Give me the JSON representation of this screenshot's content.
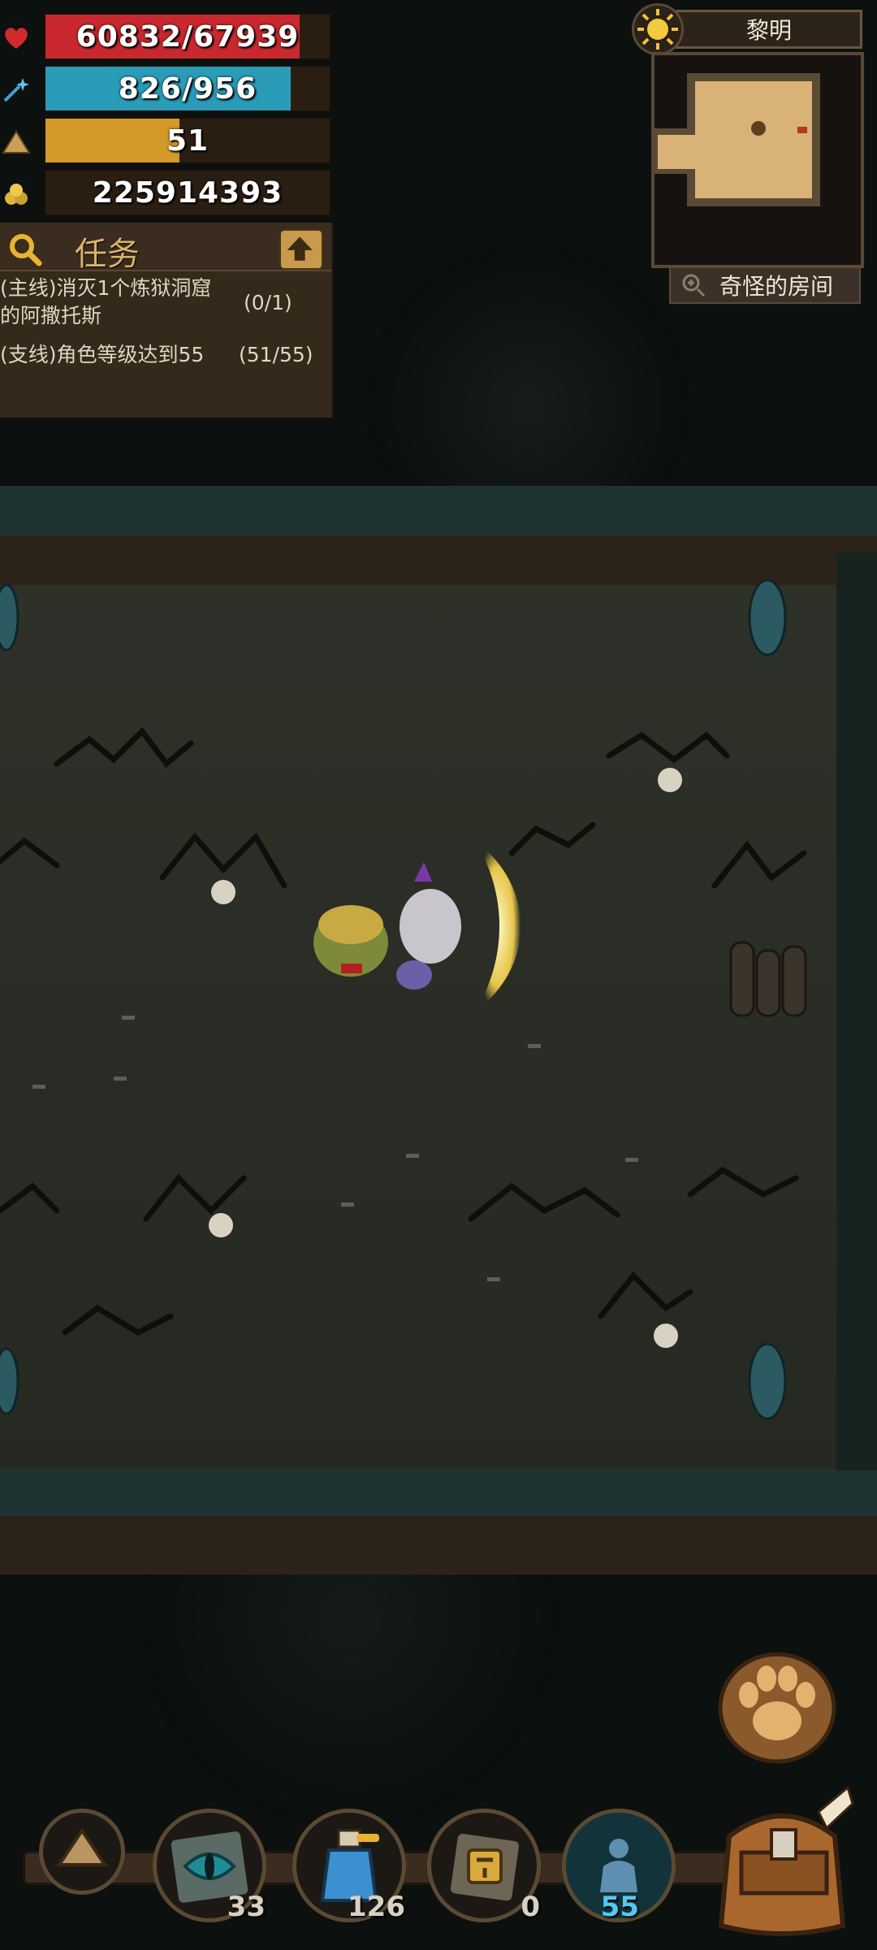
{
  "hud": {
    "hp": {
      "text": "60832/67939",
      "fraction": 0.895,
      "color": "#c9282e",
      "icon": "heart-icon"
    },
    "mp": {
      "text": "826/956",
      "fraction": 0.864,
      "color": "#2a9cb8",
      "icon": "magic-wand-icon"
    },
    "level": {
      "text": "51",
      "fraction": 0.47,
      "color": "#d39a2a",
      "icon": "level-triangle-icon"
    },
    "gold": {
      "text": "225914393",
      "color": "#d1a43a",
      "icon": "gold-pile-icon"
    }
  },
  "quest": {
    "title": "任务",
    "items": [
      {
        "text": "(主线)消灭1个炼狱洞窟的阿撒托斯",
        "progress": "(0/1)"
      },
      {
        "text": "(支线)角色等级达到55",
        "progress": "(51/55)"
      }
    ]
  },
  "minimap": {
    "time_of_day": "黎明",
    "room_name": "奇怪的房间"
  },
  "bottom_bar": {
    "slots": [
      {
        "name": "up-arrow-button",
        "count": ""
      },
      {
        "name": "cat-eye-skill",
        "count": "33"
      },
      {
        "name": "potion-bottle",
        "count": "126"
      },
      {
        "name": "swap-skill",
        "count": "0"
      },
      {
        "name": "ghost-skill",
        "count": "55"
      }
    ]
  }
}
